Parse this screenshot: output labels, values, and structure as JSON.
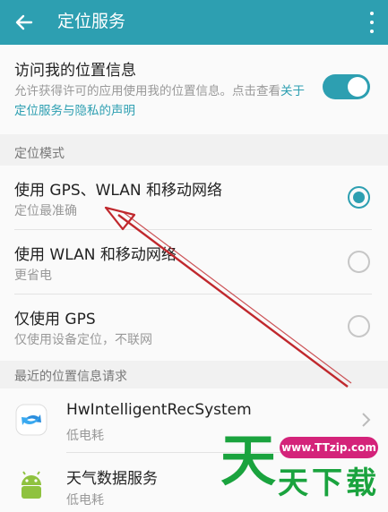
{
  "appbar": {
    "title": "定位服务"
  },
  "access": {
    "title": "访问我的位置信息",
    "desc_prefix": "允许获得许可的应用使用我的位置信息。点击查看",
    "desc_link": "关于定位服务与隐私的声明",
    "toggle_on": true
  },
  "mode_section": "定位模式",
  "modes": [
    {
      "title": "使用 GPS、WLAN 和移动网络",
      "subtitle": "定位最准确",
      "selected": true
    },
    {
      "title": "使用 WLAN 和移动网络",
      "subtitle": "更省电",
      "selected": false
    },
    {
      "title": "仅使用 GPS",
      "subtitle": "仅使用设备定位，不联网",
      "selected": false
    }
  ],
  "recent_section": "最近的位置信息请求",
  "recent": [
    {
      "name": "HwIntelligentRecSystem",
      "sub": "低电耗",
      "icon": "hw-recsystem-icon"
    },
    {
      "name": "天气数据服务",
      "sub": "低电耗",
      "icon": "android-icon"
    }
  ],
  "watermark": {
    "url": "www.TTzip.com",
    "big": "天",
    "text": "天下载"
  },
  "colors": {
    "accent": "#2d9fb1",
    "annotation": "#c0282d",
    "watermark": "#1aa33e"
  }
}
